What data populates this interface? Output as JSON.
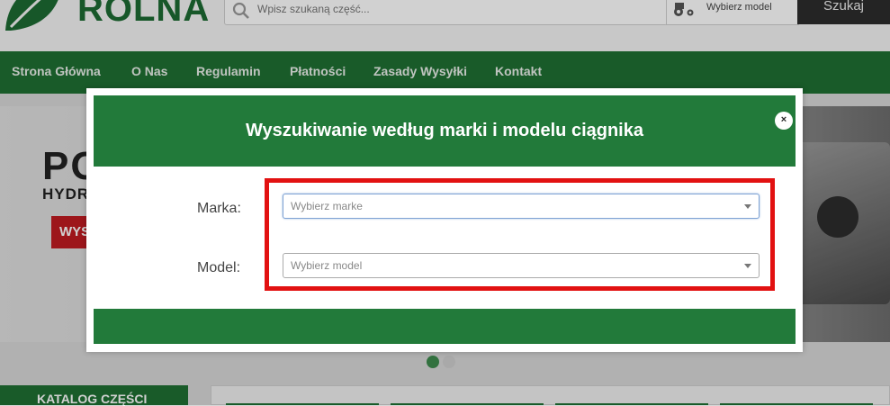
{
  "header": {
    "logo_text": "ROLNA",
    "search": {
      "placeholder": "Wpisz szukaną część..."
    },
    "model_picker_label": "Wybierz model",
    "search_button": "Szukaj"
  },
  "nav": {
    "items": [
      {
        "label": "Strona Główna"
      },
      {
        "label": "O Nas"
      },
      {
        "label": "Regulamin"
      },
      {
        "label": "Płatności"
      },
      {
        "label": "Zasady Wysyłki"
      },
      {
        "label": "Kontakt"
      }
    ]
  },
  "banner": {
    "headline": "PO",
    "subline": "HYDR",
    "button_label": "WYS"
  },
  "sidebar": {
    "catalog_label": "KATALOG CZĘŚCI"
  },
  "slider": {
    "active_index": 0,
    "count": 2
  },
  "modal": {
    "title": "Wyszukiwanie według marki i modelu ciągnika",
    "close_label": "×",
    "brand": {
      "label": "Marka:",
      "value": "Wybierz marke"
    },
    "model": {
      "label": "Model:",
      "value": "Wybierz model"
    }
  },
  "colors": {
    "brand_green": "#227a3a",
    "nav_green": "#1f6f33",
    "highlight_red": "#e21111",
    "accent_red": "#c01c22"
  },
  "icons": [
    "leaf-logo-icon",
    "search-icon",
    "tractor-icon",
    "close-icon",
    "chevron-down-icon"
  ]
}
